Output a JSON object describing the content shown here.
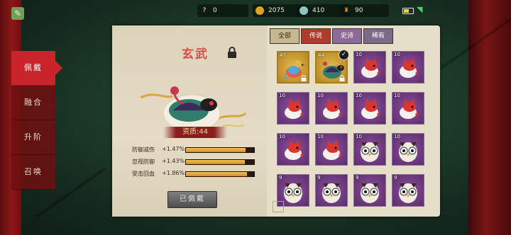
{
  "statusbar": {
    "resources": [
      {
        "icon": "question-icon",
        "value": "0"
      },
      {
        "icon": "gold-coin-icon",
        "value": "2075"
      },
      {
        "icon": "gem-icon",
        "value": "410"
      },
      {
        "icon": "tower-icon",
        "value": "90"
      }
    ],
    "battery_level": 0.6
  },
  "sidebar": {
    "items": [
      {
        "label": "佩戴",
        "active": true
      },
      {
        "label": "融合",
        "active": false
      },
      {
        "label": "升阶",
        "active": false
      },
      {
        "label": "召唤",
        "active": false
      }
    ]
  },
  "pet": {
    "name": "玄武",
    "quality": "资质:44",
    "stats": [
      {
        "label": "防御减伤",
        "value": "+1.47%",
        "fill": 0.88
      },
      {
        "label": "忽视防御",
        "value": "+1.43%",
        "fill": 0.86
      },
      {
        "label": "受击回血",
        "value": "+1.86%",
        "fill": 0.9
      }
    ],
    "worn_button": "已佩戴"
  },
  "tabs": [
    {
      "label": "全部",
      "active": true
    },
    {
      "label": "传说",
      "active": false
    },
    {
      "label": "史诗",
      "active": false
    },
    {
      "label": "稀有",
      "active": false
    }
  ],
  "grid": [
    {
      "level": "47",
      "type": "bird",
      "gold": true,
      "locked": true,
      "equipped": false
    },
    {
      "level": "44",
      "type": "turtle",
      "gold": true,
      "locked": true,
      "equipped": true
    },
    {
      "level": "10",
      "type": "fox",
      "gold": false
    },
    {
      "level": "10",
      "type": "fox",
      "gold": false
    },
    {
      "level": "10",
      "type": "fox",
      "gold": false
    },
    {
      "level": "10",
      "type": "fox",
      "gold": false
    },
    {
      "level": "10",
      "type": "fox",
      "gold": false
    },
    {
      "level": "10",
      "type": "fox",
      "gold": false
    },
    {
      "level": "10",
      "type": "fox",
      "gold": false
    },
    {
      "level": "10",
      "type": "fox",
      "gold": false
    },
    {
      "level": "10",
      "type": "owl",
      "gold": false
    },
    {
      "level": "10",
      "type": "owl",
      "gold": false
    },
    {
      "level": "9",
      "type": "owl",
      "gold": false
    },
    {
      "level": "9",
      "type": "owl",
      "gold": false
    },
    {
      "level": "9",
      "type": "owl",
      "gold": false
    },
    {
      "level": "9",
      "type": "owl",
      "gold": false
    }
  ],
  "colors": {
    "accent_red": "#c8242a",
    "pet_name": "#d4514a",
    "gold_bar": "#f4c45a",
    "rare_purple": "#8e4f9e"
  }
}
